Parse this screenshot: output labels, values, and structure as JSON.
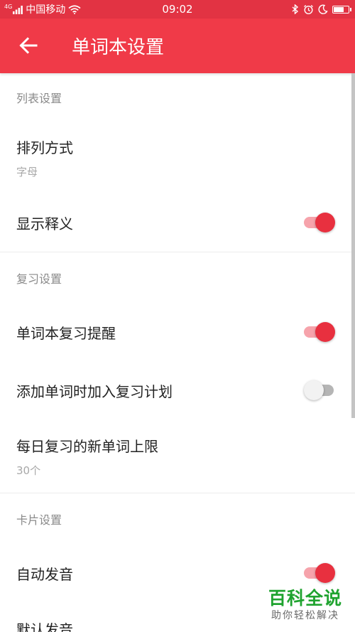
{
  "status_bar": {
    "signal_text": "4G",
    "carrier": "中国移动",
    "time": "09:02",
    "battery_level": 0.75,
    "icons": [
      "signal-icon",
      "wifi-icon",
      "bluetooth-icon",
      "alarm-icon",
      "moon-icon",
      "battery-icon"
    ]
  },
  "app_bar": {
    "title": "单词本设置",
    "back_icon": "arrow-left-icon"
  },
  "sections": {
    "list": {
      "header": "列表设置",
      "sort": {
        "title": "排列方式",
        "value": "字母"
      },
      "show_meaning": {
        "title": "显示释义",
        "enabled": true
      }
    },
    "review": {
      "header": "复习设置",
      "reminder": {
        "title": "单词本复习提醒",
        "enabled": true
      },
      "add_to_plan": {
        "title": "添加单词时加入复习计划",
        "enabled": false
      },
      "daily_limit": {
        "title": "每日复习的新单词上限",
        "value": "30个"
      }
    },
    "card": {
      "header": "卡片设置",
      "auto_pronounce": {
        "title": "自动发音",
        "enabled": true
      },
      "default_pronounce": {
        "title": "默认发音"
      }
    }
  },
  "watermark": {
    "main": "百科全说",
    "sub": "助你轻松解决"
  },
  "colors": {
    "app_bar": "#f03a48",
    "status_bar": "#e23343",
    "toggle_on": "#e8303f",
    "watermark": "#1fa32f"
  }
}
